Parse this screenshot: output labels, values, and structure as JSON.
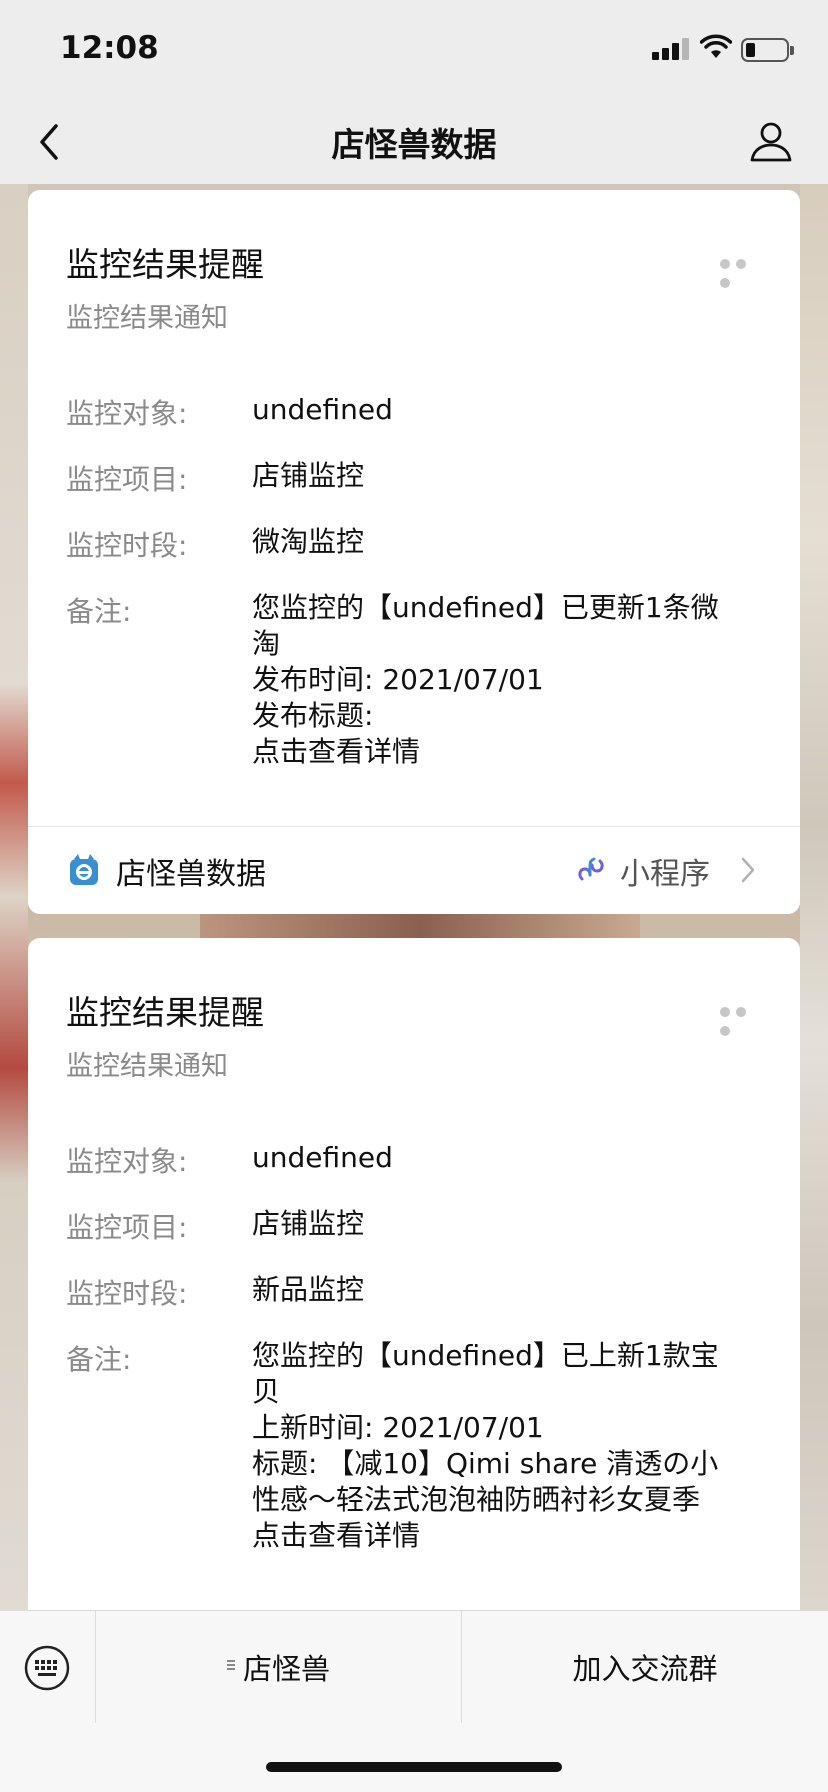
{
  "status_bar": {
    "time": "12:08"
  },
  "nav": {
    "title": "店怪兽数据"
  },
  "cards": [
    {
      "title": "监控结果提醒",
      "subtitle": "监控结果通知",
      "fields": {
        "object_label": "监控对象:",
        "object_value": "undefined",
        "item_label": "监控项目:",
        "item_value": "店铺监控",
        "period_label": "监控时段:",
        "period_value": "微淘监控",
        "note_label": "备注:",
        "note_lines": [
          "您监控的【undefined】已更新1条微",
          "淘",
          "发布时间: 2021/07/01",
          "发布标题:",
          "点击查看详情"
        ]
      },
      "footer": {
        "app_name": "店怪兽数据",
        "type": "小程序"
      }
    },
    {
      "title": "监控结果提醒",
      "subtitle": "监控结果通知",
      "fields": {
        "object_label": "监控对象:",
        "object_value": "undefined",
        "item_label": "监控项目:",
        "item_value": "店铺监控",
        "period_label": "监控时段:",
        "period_value": "新品监控",
        "note_label": "备注:",
        "note_lines": [
          "您监控的【undefined】已上新1款宝",
          "贝",
          "上新时间: 2021/07/01",
          "标题: 【减10】Qimi share 清透の小",
          "性感～轻法式泡泡袖防晒衬衫女夏季",
          "点击查看详情"
        ]
      }
    }
  ],
  "bottom_menu": {
    "item1": "店怪兽",
    "item2": "加入交流群"
  },
  "colors": {
    "background": "#ededed",
    "card": "#ffffff",
    "muted_text": "#8a8a8a",
    "accent_logo": "#3a8fd0"
  }
}
